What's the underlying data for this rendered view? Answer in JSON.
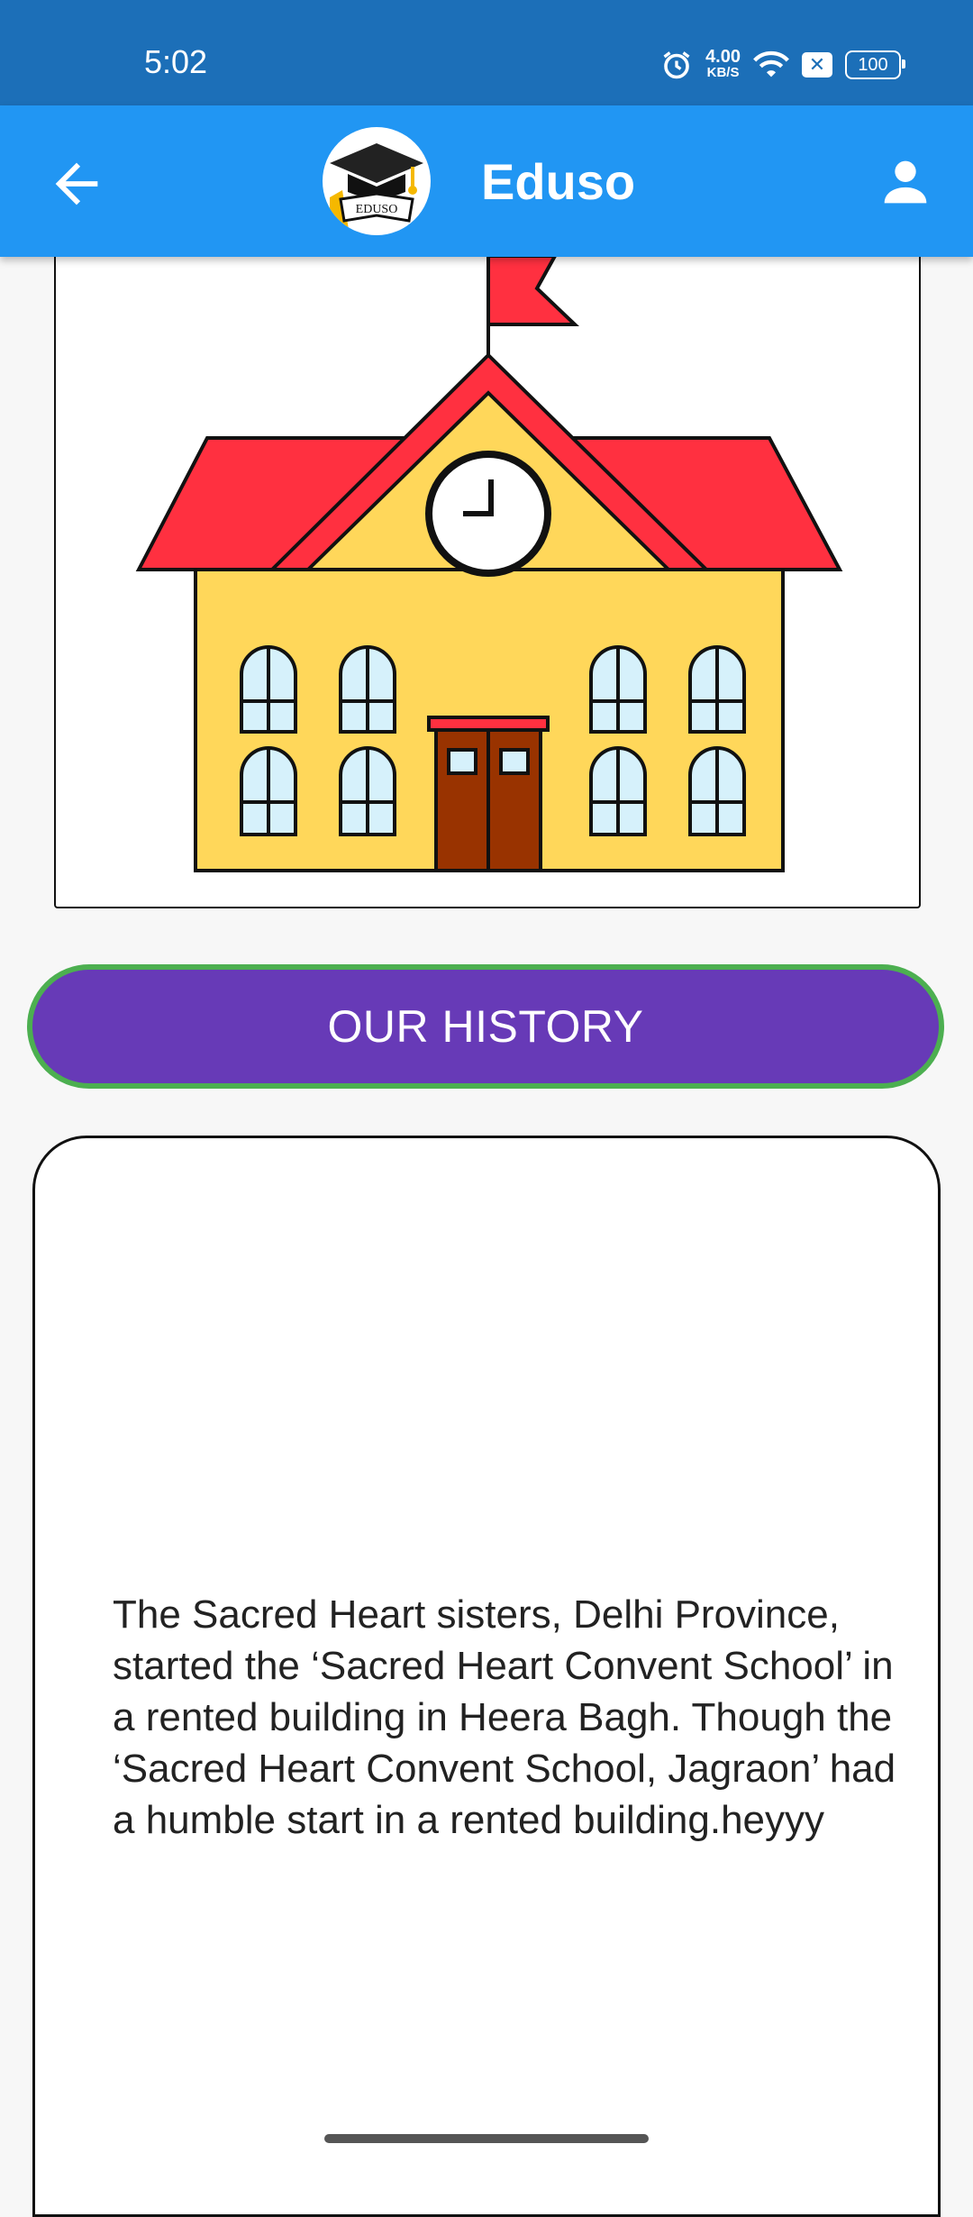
{
  "status_bar": {
    "time": "5:02",
    "net_speed_value": "4.00",
    "net_speed_unit": "KB/S",
    "battery": "100"
  },
  "app_bar": {
    "title": "Eduso",
    "logo_text": "EDUSO"
  },
  "history_button_label": "OUR HISTORY",
  "history_text": "The Sacred Heart sisters, Delhi Province, started the ‘Sacred Heart Convent School’ in a rented building in Heera Bagh. Though the ‘Sacred Heart Convent School, Jagraon’ had a humble start in a rented building.heyyy",
  "colors": {
    "status_bar": "#1c6fb8",
    "app_bar": "#2196f3",
    "button_fill": "#673ab7",
    "button_border": "#4caf50",
    "roof": "#ff3040",
    "wall": "#ffd75a",
    "door": "#993300"
  }
}
